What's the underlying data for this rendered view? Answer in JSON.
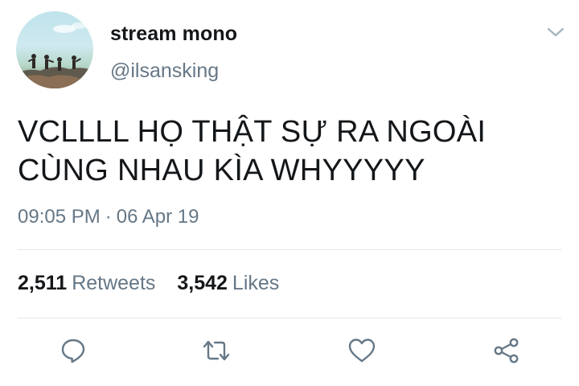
{
  "user": {
    "display_name": "stream mono",
    "handle": "@ilsansking",
    "avatar_icon": "avatar-photo-group-on-rocks"
  },
  "tweet": {
    "lines": [
      "VCLLLL HỌ THẬT SỰ RA NGOÀI",
      "CÙNG NHAU KÌA WHYYYYY"
    ],
    "time": "09:05 PM",
    "separator": "·",
    "date": "06 Apr 19"
  },
  "stats": {
    "retweets_count": "2,511",
    "retweets_label": "Retweets",
    "likes_count": "3,542",
    "likes_label": "Likes"
  },
  "actions": {
    "reply_icon": "reply-icon",
    "retweet_icon": "retweet-icon",
    "like_icon": "heart-icon",
    "share_icon": "share-icon"
  },
  "colors": {
    "text_primary": "#14171a",
    "text_secondary": "#657786",
    "divider": "#e1e8ed",
    "icon": "#657786"
  }
}
